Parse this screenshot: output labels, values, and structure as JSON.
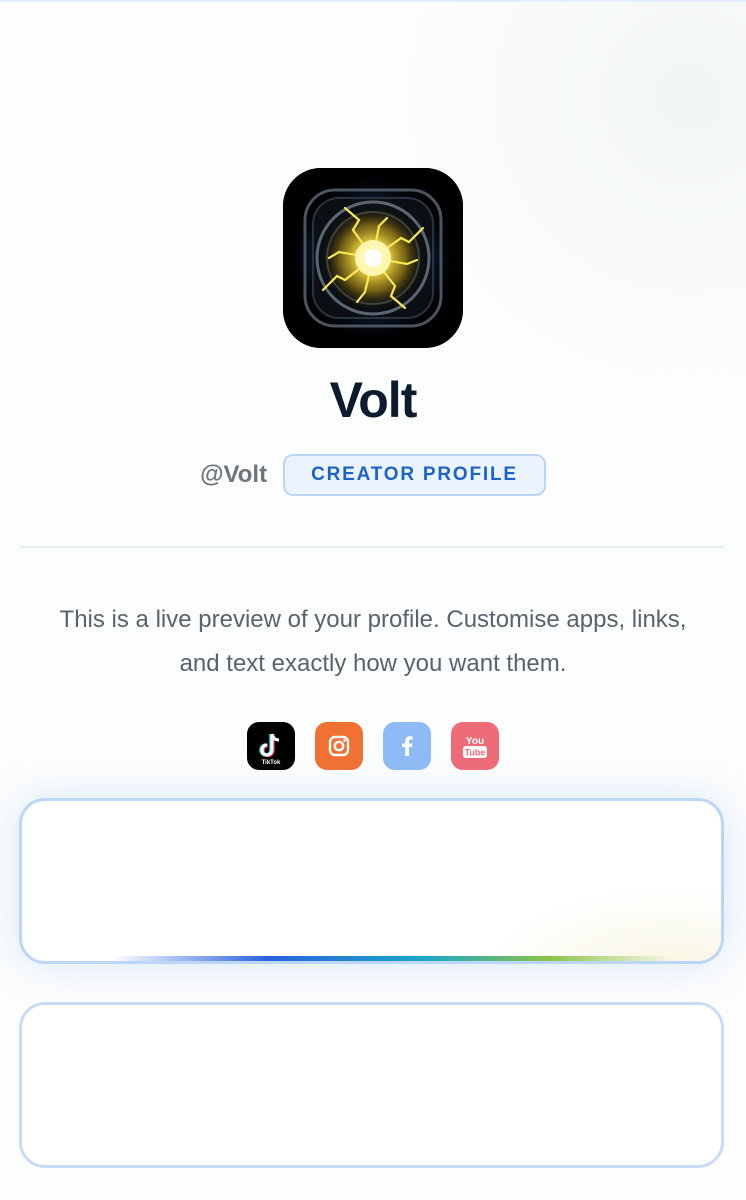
{
  "profile": {
    "name": "Volt",
    "handle": "@Volt",
    "badge": "CREATOR PROFILE",
    "bio": "This is a live preview of your profile. Customise apps, links, and text exactly how you want them."
  },
  "avatar": {
    "icon": "electric-orb-icon",
    "accent": "#f7e04a"
  },
  "socials": [
    {
      "name": "TikTok",
      "icon": "tiktok-icon",
      "color": "#000000"
    },
    {
      "name": "Instagram",
      "icon": "instagram-icon",
      "color": "#f07132"
    },
    {
      "name": "Facebook",
      "icon": "facebook-icon",
      "color": "#8ebaf5"
    },
    {
      "name": "YouTube",
      "icon": "youtube-icon",
      "color": "#ee6b78"
    }
  ],
  "social_labels": {
    "tiktok": "TikTok",
    "youtube_top": "You",
    "youtube_bottom": "Tube"
  },
  "links": [
    {
      "label": ""
    },
    {
      "label": ""
    }
  ],
  "colors": {
    "badge_text": "#1b63c6",
    "badge_bg": "#eaf3fe",
    "card_border": "#bcd6f7",
    "title": "#0d1b2e"
  }
}
